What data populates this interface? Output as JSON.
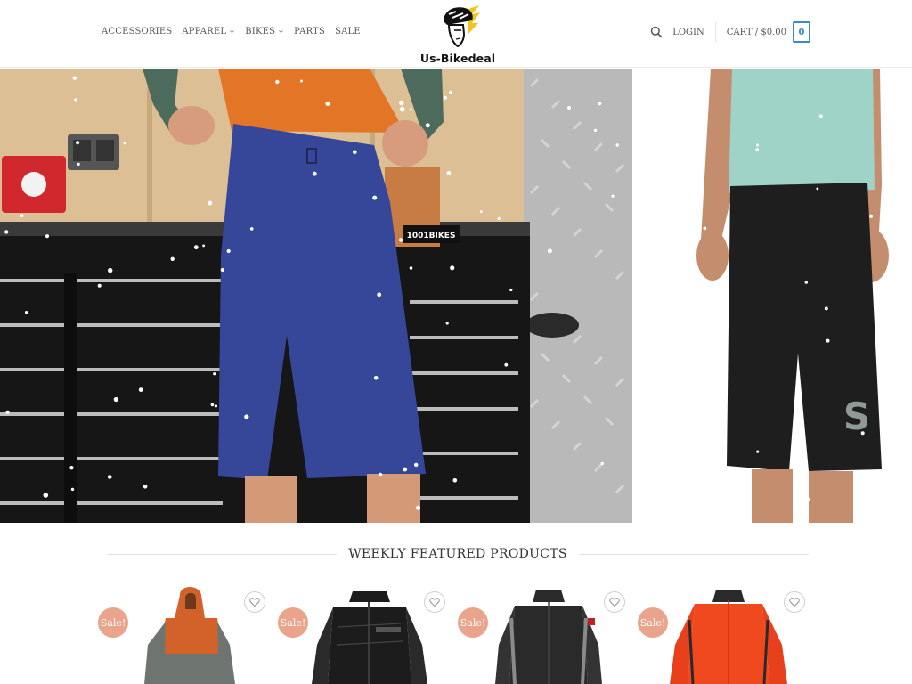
{
  "site": {
    "name": "Us-Bikedeal"
  },
  "nav": [
    {
      "label": "ACCESSORIES",
      "has_dropdown": false
    },
    {
      "label": "APPAREL",
      "has_dropdown": true
    },
    {
      "label": "BIKES",
      "has_dropdown": true
    },
    {
      "label": "PARTS",
      "has_dropdown": false
    },
    {
      "label": "SALE",
      "has_dropdown": false
    }
  ],
  "header": {
    "login_label": "LOGIN",
    "cart_label": "CART / $0.00",
    "cart_count": "0"
  },
  "hero": {
    "left_shop_sign": "1001BIKES",
    "right_brand_mark": "S"
  },
  "featured": {
    "title": "WEEKLY FEATURED PRODUCTS",
    "products": [
      {
        "badge": "Sale!",
        "image": "orange-grey-hooded-jacket",
        "color_main": "#d2622a",
        "color_secondary": "#6e7470"
      },
      {
        "badge": "Sale!",
        "image": "black-scott-rain-jacket",
        "color_main": "#1c1c1c",
        "color_secondary": "#3a3a3a"
      },
      {
        "badge": "Sale!",
        "image": "black-grey-jersey",
        "color_main": "#2a2a2a",
        "color_secondary": "#8a8a8a"
      },
      {
        "badge": "Sale!",
        "image": "red-orange-jersey",
        "color_main": "#f0491e",
        "color_secondary": "#2a2a2a"
      }
    ]
  },
  "colors": {
    "accent_blue": "#3a8bc4",
    "sale_badge": "#e9a48b"
  }
}
